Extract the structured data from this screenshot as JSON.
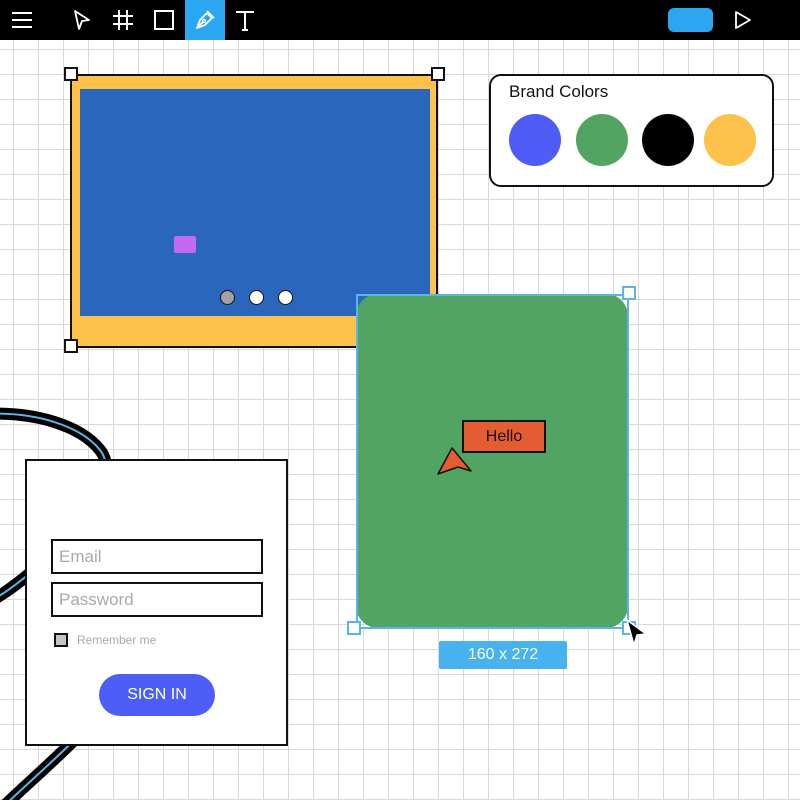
{
  "toolbar": {
    "tools": [
      {
        "name": "menu-icon",
        "active": false
      },
      {
        "name": "select-arrow-icon",
        "active": false
      },
      {
        "name": "frame-grid-icon",
        "active": false
      },
      {
        "name": "rectangle-icon",
        "active": false
      },
      {
        "name": "pen-icon",
        "active": true
      },
      {
        "name": "text-icon",
        "active": false
      }
    ],
    "play_icon": "play-icon",
    "accent_color": "#2aa7f0"
  },
  "brand": {
    "title": "Brand Colors",
    "colors": [
      "#4f5cf6",
      "#51a462",
      "#000000",
      "#fec149"
    ]
  },
  "login": {
    "email_placeholder": "Email",
    "password_placeholder": "Password",
    "remember_label": "Remember me",
    "signin_label": "SIGN IN"
  },
  "green_card": {
    "hello_label": "Hello",
    "size_label": "160 x 272"
  },
  "carousel": {
    "dot_count": 3,
    "active_dot": 0
  }
}
